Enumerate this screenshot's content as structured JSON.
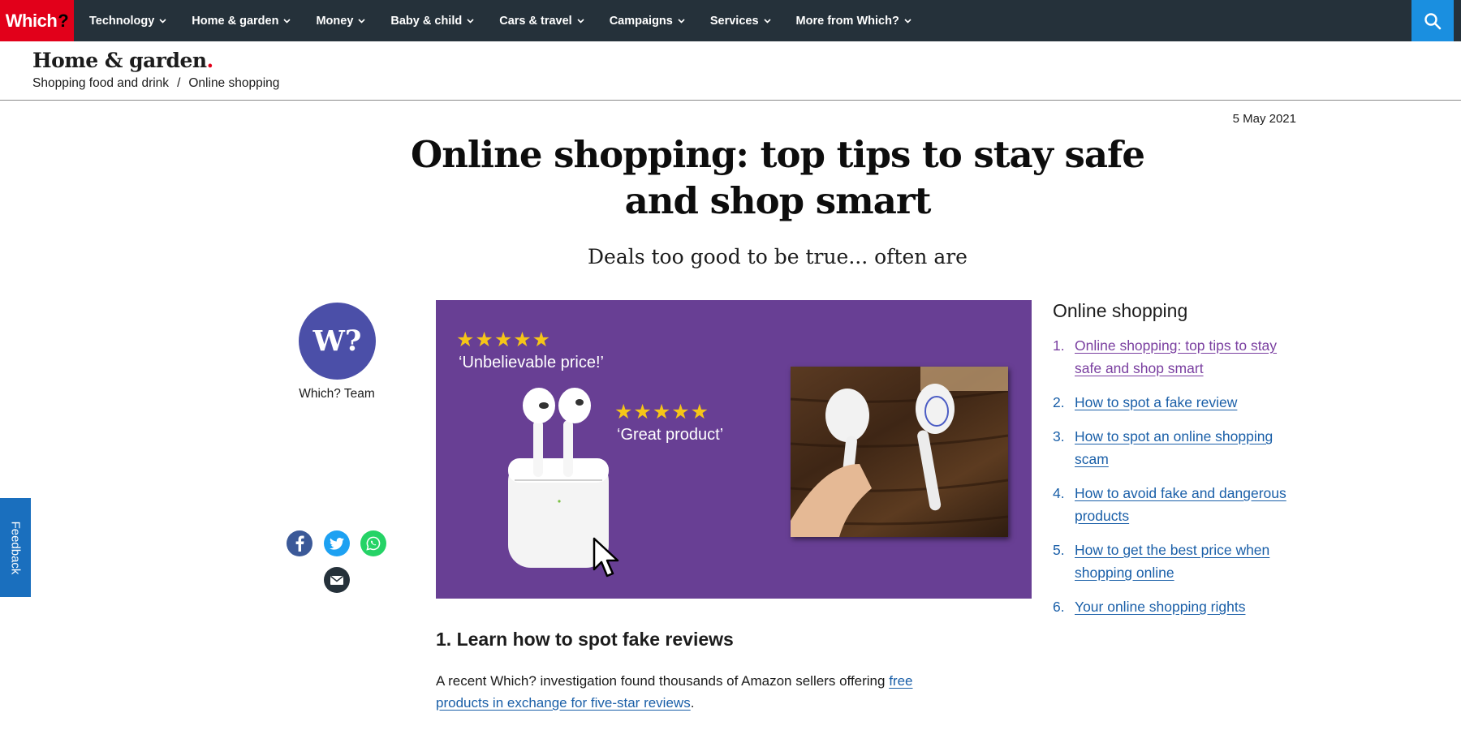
{
  "brand": {
    "logo": "Which",
    "logo_mark": "?"
  },
  "nav": {
    "items": [
      "Technology",
      "Home & garden",
      "Money",
      "Baby & child",
      "Cars & travel",
      "Campaigns",
      "Services",
      "More from Which?"
    ],
    "search_icon": "search-icon"
  },
  "section": {
    "title": "Home & garden",
    "title_dot": ".",
    "breadcrumb": [
      "Shopping food and drink",
      "Online shopping"
    ],
    "breadcrumb_sep": "/"
  },
  "article": {
    "date": "5 May 2021",
    "title": "Online shopping: top tips to stay safe and shop smart",
    "subtitle": "Deals too good to be true... often are",
    "author": {
      "avatar_text": "W?",
      "name": "Which? Team"
    },
    "share_icons": [
      "facebook-icon",
      "twitter-icon",
      "whatsapp-icon",
      "email-icon"
    ],
    "hero": {
      "stars_1": "★★★★★",
      "quote_1": "‘Unbelievable price!’",
      "stars_2": "★★★★★",
      "quote_2": "‘Great product’"
    },
    "section_1_heading": "1. Learn how to spot fake reviews",
    "para_1_text": "A recent Which? investigation found thousands of Amazon sellers offering ",
    "para_1_link": "free products in exchange for five-star reviews",
    "para_1_end": "."
  },
  "feedback": {
    "label": "Feedback"
  },
  "toc": {
    "heading": "Online shopping",
    "items": [
      {
        "num": "1.",
        "label": "Online shopping: top tips to stay safe and shop smart"
      },
      {
        "num": "2.",
        "label": "How to spot a fake review"
      },
      {
        "num": "3.",
        "label": "How to spot an online shopping scam"
      },
      {
        "num": "4.",
        "label": "How to avoid fake and dangerous products"
      },
      {
        "num": "5.",
        "label": "How to get the best price when shopping online"
      },
      {
        "num": "6.",
        "label": "Your online shopping rights"
      }
    ]
  },
  "colors": {
    "brand_red": "#e2001a",
    "nav_bg": "#25313a",
    "search_bg": "#1a8fe0",
    "link": "#1a5fa8",
    "link_visited": "#7a3fa0",
    "hero_bg": "#683f94",
    "avatar_bg": "#4b4fa8"
  }
}
